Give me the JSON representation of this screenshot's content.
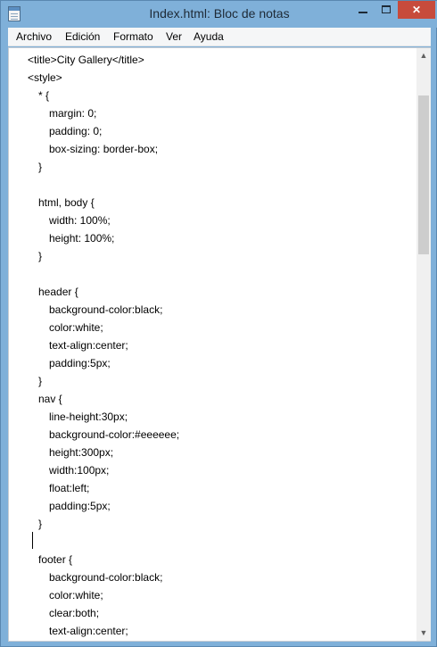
{
  "window": {
    "title": "Index.html: Bloc de notas",
    "icon": "notepad-icon",
    "controls": {
      "minimize_icon": "minimize-icon",
      "maximize_icon": "maximize-icon",
      "close_label": "✕"
    }
  },
  "menu": {
    "items": [
      "Archivo",
      "Edición",
      "Formato",
      "Ver",
      "Ayuda"
    ]
  },
  "editor": {
    "lines": [
      "<title>City Gallery</title>",
      "<style>",
      "* {",
      "margin: 0;",
      "padding: 0;",
      "box-sizing: border-box;",
      "}",
      "",
      "html, body {",
      "width: 100%;",
      "height: 100%;",
      "}",
      "",
      "header {",
      "background-color:black;",
      "color:white;",
      "text-align:center;",
      "padding:5px;",
      "}",
      "nav {",
      "line-height:30px;",
      "background-color:#eeeeee;",
      "height:300px;",
      "width:100px;",
      "float:left;",
      "padding:5px;",
      "}",
      "",
      "footer {",
      "background-color:black;",
      "color:white;",
      "clear:both;",
      "text-align:center;"
    ]
  },
  "scrollbar": {
    "up_glyph": "▲",
    "down_glyph": "▼"
  }
}
